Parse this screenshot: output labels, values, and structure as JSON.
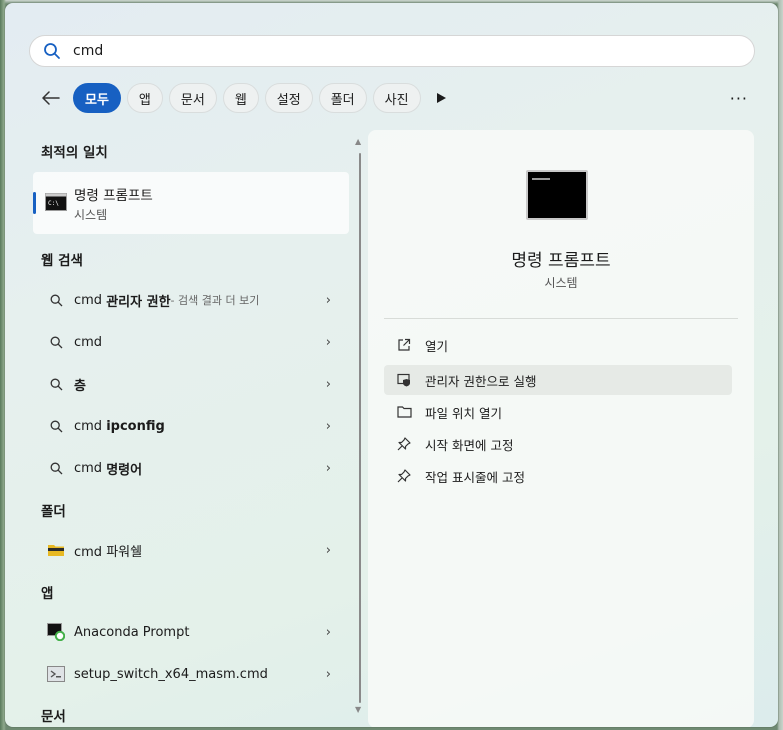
{
  "search": {
    "value": "cmd",
    "icon": "search-icon"
  },
  "filters": {
    "tabs": [
      {
        "label": "모두",
        "active": true
      },
      {
        "label": "앱"
      },
      {
        "label": "문서"
      },
      {
        "label": "웹"
      },
      {
        "label": "설정"
      },
      {
        "label": "폴더"
      },
      {
        "label": "사진"
      }
    ],
    "more_label": "···"
  },
  "left": {
    "best_match_title": "최적의 일치",
    "best_match": {
      "title": "명령 프롬프트",
      "subtitle": "시스템"
    },
    "web_title": "웹 검색",
    "web_items": [
      {
        "prefix": "cmd",
        "bold": "관리자 권한",
        "suffix": " - 검색 결과 더 보기"
      },
      {
        "prefix": "cmd",
        "bold": "",
        "suffix": ""
      },
      {
        "prefix": "",
        "bold": "층",
        "suffix": ""
      },
      {
        "prefix": "cmd",
        "bold": "ipconfig",
        "suffix": ""
      },
      {
        "prefix": "cmd",
        "bold": "명령어",
        "suffix": ""
      }
    ],
    "folder_title": "폴더",
    "folder_item": "cmd 파워쉘",
    "app_title": "앱",
    "app_items": [
      "Anaconda Prompt",
      "setup_switch_x64_masm.cmd"
    ],
    "docs_title": "문서",
    "chevron": "›"
  },
  "right": {
    "title": "명령 프롬프트",
    "subtitle": "시스템",
    "actions": [
      {
        "label": "열기",
        "icon": "open-external-icon"
      },
      {
        "label": "관리자 권한으로 실행",
        "icon": "shield-admin-icon"
      },
      {
        "label": "파일 위치 열기",
        "icon": "folder-icon"
      },
      {
        "label": "시작 화면에 고정",
        "icon": "pin-icon"
      },
      {
        "label": "작업 표시줄에 고정",
        "icon": "pin-icon"
      }
    ]
  },
  "colors": {
    "accent": "#1760c2"
  }
}
